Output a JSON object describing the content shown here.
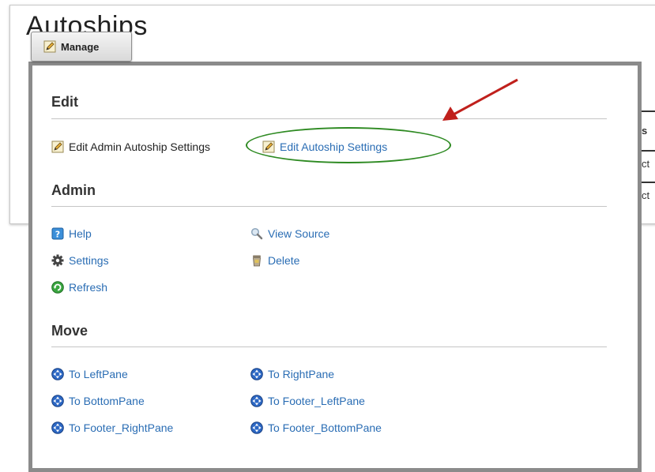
{
  "module": {
    "title": "Autoships",
    "table_fragments": [
      "s",
      "ct",
      "ct"
    ]
  },
  "manage_button": {
    "label": "Manage",
    "icon": "pencil-icon"
  },
  "sections": {
    "edit": {
      "heading": "Edit",
      "items": [
        {
          "label": "Edit Admin Autoship Settings",
          "icon": "pencil-icon"
        },
        {
          "label": "Edit Autoship Settings",
          "icon": "pencil-icon"
        }
      ]
    },
    "admin": {
      "heading": "Admin",
      "items": [
        {
          "label": "Help",
          "icon": "help-icon"
        },
        {
          "label": "View Source",
          "icon": "magnifier-icon"
        },
        {
          "label": "Settings",
          "icon": "gear-icon"
        },
        {
          "label": "Delete",
          "icon": "trash-icon"
        },
        {
          "label": "Refresh",
          "icon": "refresh-icon"
        }
      ]
    },
    "move": {
      "heading": "Move",
      "items": [
        {
          "label": "To LeftPane",
          "icon": "move-arrows-icon"
        },
        {
          "label": "To RightPane",
          "icon": "move-arrows-icon"
        },
        {
          "label": "To BottomPane",
          "icon": "move-arrows-icon"
        },
        {
          "label": "To Footer_LeftPane",
          "icon": "move-arrows-icon"
        },
        {
          "label": "To Footer_RightPane",
          "icon": "move-arrows-icon"
        },
        {
          "label": "To Footer_BottomPane",
          "icon": "move-arrows-icon"
        }
      ]
    }
  },
  "annotation_colors": {
    "arrow": "#c0201c",
    "ellipse": "#2e8a22"
  }
}
